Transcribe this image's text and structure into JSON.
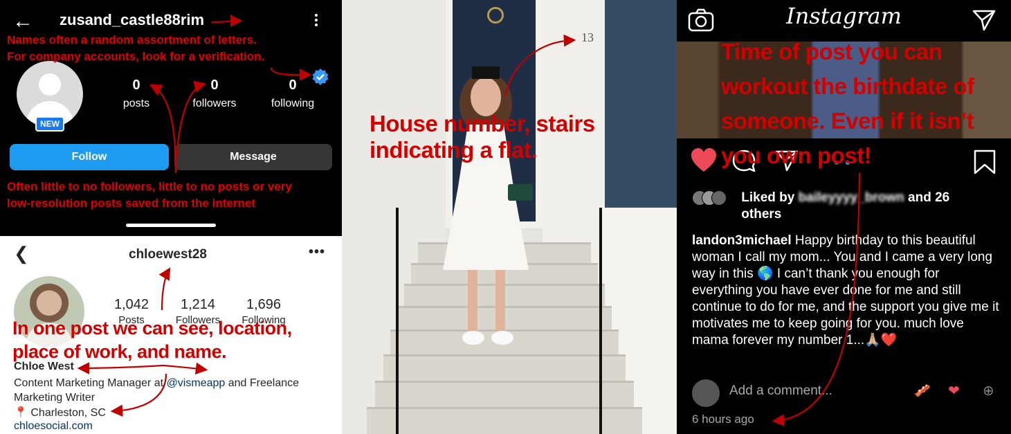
{
  "panel1": {
    "username": "zusand_castle88rim",
    "badge": "NEW",
    "stats": [
      {
        "value": "0",
        "label": "posts"
      },
      {
        "value": "0",
        "label": "followers"
      },
      {
        "value": "0",
        "label": "following"
      }
    ],
    "follow_label": "Follow",
    "message_label": "Message",
    "annotation_top": "Names often a random assortment of letters.\nFor company accounts, look for a verification.",
    "annotation_bottom": "Often little to no followers, little to no posts or very\nlow-resolution posts saved from the internet"
  },
  "panel2": {
    "username": "chloewest28",
    "stats": [
      {
        "value": "1,042",
        "label": "Posts"
      },
      {
        "value": "1,214",
        "label": "Followers"
      },
      {
        "value": "1,696",
        "label": "Following"
      }
    ],
    "name": "Chloe West",
    "bio_prefix": "Content Marketing Manager at ",
    "bio_mention": "@vismeapp",
    "bio_suffix": " and Freelance Marketing Writer",
    "location": "Charleston, SC",
    "link": "chloesocial.com",
    "annotation": "In one post we can see, location,\nplace of work, and name."
  },
  "panel3": {
    "house_number": "13",
    "annotation": "House number, stairs\nindicating a flat."
  },
  "panel4": {
    "app_title": "Instagram",
    "annotation": "Time of post you can workout the birthdate of someone. Even if it isn’t you own post!",
    "liked_prefix": "Liked by ",
    "liked_user": "baileyyyy_brown",
    "liked_suffix": " and 26 others",
    "caption_user": "landon3michael",
    "caption_text": " Happy birthday to this beautiful woman I call my mom... You and I came a very long way in this 🌎 I can’t thank you enough for everything you have ever done for me and still continue to do for me, and the support you give me it motivates me to keep going for you. much love mama forever my number 1...🙏🏼❤️",
    "comment_placeholder": "Add a comment...",
    "timestamp": "6 hours ago",
    "icons": [
      "camera-icon",
      "send-icon",
      "heart-icon",
      "comment-icon",
      "share-icon",
      "bookmark-icon"
    ]
  },
  "colors": {
    "annotation": "#e00000",
    "follow_blue": "#1d9bf0",
    "like_red": "#ed4956"
  }
}
